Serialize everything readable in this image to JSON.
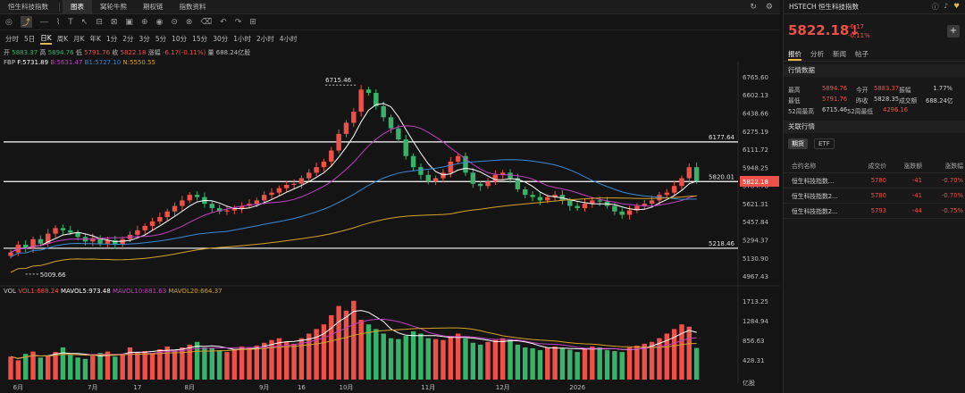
{
  "tabbar": {
    "tabs": [
      "恒生科技指数",
      "图表",
      "窝轮牛熊",
      "期权链",
      "指数资料"
    ],
    "active": 1
  },
  "toolbar": {
    "icons": [
      "camera-icon",
      "indicator-icon",
      "line-icon",
      "brush-icon",
      "text-icon",
      "arrow-icon",
      "measure-icon",
      "ruler-icon",
      "image-icon",
      "zoom-icon",
      "eye-icon",
      "lock-icon",
      "magnet-icon",
      "trash-icon",
      "undo-icon",
      "redo-icon",
      "layout-icon"
    ]
  },
  "periods": [
    "分时",
    "5日",
    "日K",
    "周K",
    "月K",
    "年K",
    "1分",
    "2分",
    "3分",
    "5分",
    "10分",
    "15分",
    "30分",
    "1小时",
    "2小时",
    "4小时"
  ],
  "active_period": "日K",
  "ohlc": {
    "open_label": "开",
    "open": "5883.37",
    "high_label": "高",
    "high": "5894.76",
    "low_label": "低",
    "low": "5791.76",
    "close_label": "收",
    "close": "5822.18",
    "chg_label": "涨幅",
    "chg": "-6.17(-0.11%)",
    "vol_label": "量",
    "vol": "688.24亿股"
  },
  "ma": {
    "label": "FBP",
    "f": "F:5731.89",
    "b": "B:5631.47",
    "b1": "B1:5727.10",
    "n": "N:5550.55"
  },
  "volume_info": {
    "label": "VOL",
    "vol1": "VOL1:688.24",
    "mavol5": "MAVOL5:973.48",
    "mavol10": "MAVOL10:881.63",
    "mavol20": "MAVOL20:664.37"
  },
  "right": {
    "symbol": "HSTECH",
    "name": "恒生科技指数",
    "price": "5822.18↓",
    "change": "-6.17",
    "change_pct": "-0.11%",
    "tabs": [
      "报价",
      "分析",
      "新闻",
      "帖子"
    ],
    "section1": "行情数据",
    "stats": [
      [
        "最高",
        "5894.76",
        "今开",
        "5883.37",
        "振幅",
        "1.77%"
      ],
      [
        "最低",
        "5791.76",
        "昨收",
        "5828.35",
        "成交额",
        "688.24亿"
      ],
      [
        "52周最高",
        "6715.46",
        "52周最低",
        "4296.16",
        "",
        ""
      ]
    ],
    "section2": "关联行情",
    "pills": [
      "期货",
      "ETF"
    ],
    "table_headers": [
      "合约名称",
      "成交价",
      "涨跌额",
      "涨跌幅"
    ],
    "table_rows": [
      [
        "恒生科技指数...",
        "5780",
        "-41",
        "-0.70%"
      ],
      [
        "恒生科技指数2...",
        "5780",
        "-41",
        "-0.70%"
      ],
      [
        "恒生科技指数2...",
        "5793",
        "-44",
        "-0.75%"
      ]
    ]
  },
  "chart_data": {
    "type": "candlestick",
    "y_ticks": [
      "6765.60",
      "6602.13",
      "6438.66",
      "6275.19",
      "6111.72",
      "5948.25",
      "5784.78",
      "5621.31",
      "5457.84",
      "5294.37",
      "5130.90",
      "4967.43"
    ],
    "vol_ticks": [
      "1713.25",
      "1284.94",
      "856.63",
      "428.31",
      "亿股"
    ],
    "x_labels": [
      "6月",
      "7月",
      "17",
      "8月",
      "9月",
      "16",
      "10月",
      "11月",
      "12月",
      "2026"
    ],
    "hlines": [
      {
        "value": 6177.64,
        "label": "6177.64"
      },
      {
        "value": 5820.01,
        "label": "5820.01"
      },
      {
        "value": 5218.46,
        "label": "5218.46"
      }
    ],
    "annotations": [
      {
        "label": "6715.46"
      },
      {
        "label": "5009.66"
      }
    ],
    "last_price": "5822.18",
    "closes": [
      5180,
      5250,
      5220,
      5300,
      5260,
      5350,
      5400,
      5380,
      5360,
      5320,
      5280,
      5310,
      5260,
      5290,
      5250,
      5300,
      5340,
      5380,
      5420,
      5460,
      5500,
      5550,
      5600,
      5650,
      5700,
      5680,
      5620,
      5580,
      5550,
      5560,
      5580,
      5600,
      5620,
      5650,
      5700,
      5720,
      5760,
      5790,
      5800,
      5850,
      5900,
      5950,
      6000,
      6100,
      6250,
      6350,
      6450,
      6650,
      6620,
      6500,
      6400,
      6300,
      6200,
      6050,
      5950,
      5880,
      5820,
      5850,
      5900,
      6000,
      6050,
      5900,
      5800,
      5780,
      5820,
      5880,
      5900,
      5850,
      5750,
      5700,
      5680,
      5650,
      5680,
      5700,
      5650,
      5600,
      5580,
      5620,
      5650,
      5640,
      5600,
      5550,
      5520,
      5560,
      5600,
      5620,
      5650,
      5700,
      5720,
      5780,
      5850,
      5950,
      5822
    ],
    "volumes": [
      500,
      420,
      560,
      610,
      480,
      520,
      600,
      700,
      540,
      480,
      450,
      520,
      580,
      610,
      500,
      560,
      700,
      600,
      620,
      580,
      660,
      720,
      640,
      700,
      760,
      820,
      700,
      680,
      640,
      600,
      660,
      720,
      700,
      740,
      800,
      860,
      900,
      820,
      780,
      900,
      1000,
      1100,
      1200,
      1400,
      1600,
      1500,
      1713,
      1300,
      1200,
      1100,
      1000,
      900,
      880,
      950,
      1050,
      1000,
      900,
      880,
      860,
      950,
      1000,
      900,
      800,
      760,
      820,
      860,
      900,
      880,
      760,
      700,
      680,
      640,
      700,
      720,
      680,
      650,
      600,
      680,
      720,
      700,
      640,
      620,
      600,
      700,
      740,
      780,
      820,
      900,
      1000,
      1100,
      1200,
      1150,
      688
    ]
  }
}
